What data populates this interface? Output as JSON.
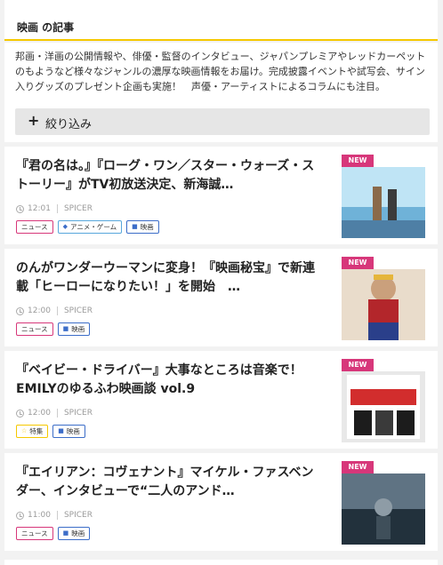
{
  "section": {
    "title": "映画 の記事"
  },
  "intro": {
    "text": "邦画・洋画の公開情報や、俳優・監督のインタビュー、ジャパンプレミアやレッドカーペットのもようなど様々なジャンルの濃厚な映画情報をお届け。完成披露イベントや試写会、サイン入りグッズのプレゼント企画も実施！　声優・アーティストによるコラムにも注目。"
  },
  "filter": {
    "label": "絞り込み"
  },
  "articles": [
    {
      "title": "『君の名は。』『ローグ・ワン／スター・ウォーズ・ストーリー』がTV初放送決定、新海誠…",
      "time": "12:01",
      "source": "SPICER",
      "tags": [
        "ニュース",
        "アニメ・ゲーム",
        "映画"
      ],
      "badge": "NEW",
      "thumb_colors": [
        "#bfe4f5",
        "#6fb2d8",
        "#8a6a4a"
      ]
    },
    {
      "title": "のんがワンダーウーマンに変身！『映画秘宝』で新連載「ヒーローになりたい！」を開始　…",
      "time": "12:00",
      "source": "SPICER",
      "tags": [
        "ニュース",
        "映画"
      ],
      "badge": "NEW",
      "thumb_colors": [
        "#caa07c",
        "#b3262b",
        "#2a3f8a"
      ]
    },
    {
      "title": "『ベイビー・ドライバー』大事なところは音楽で！　EMILYのゆるふわ映画談 vol.9",
      "time": "12:00",
      "source": "SPICER",
      "tags": [
        "特集",
        "映画"
      ],
      "badge": "NEW",
      "thumb_colors": [
        "#e8e8e8",
        "#d22d2d",
        "#1c1c1c"
      ]
    },
    {
      "title": "『エイリアン：コヴェナント』マイケル・ファスベンダー、インタビューで“二人のアンド…",
      "time": "11:00",
      "source": "SPICER",
      "tags": [
        "ニュース",
        "映画"
      ],
      "badge": "NEW",
      "thumb_colors": [
        "#5f7383",
        "#22313c",
        "#8e9ca6"
      ]
    }
  ]
}
